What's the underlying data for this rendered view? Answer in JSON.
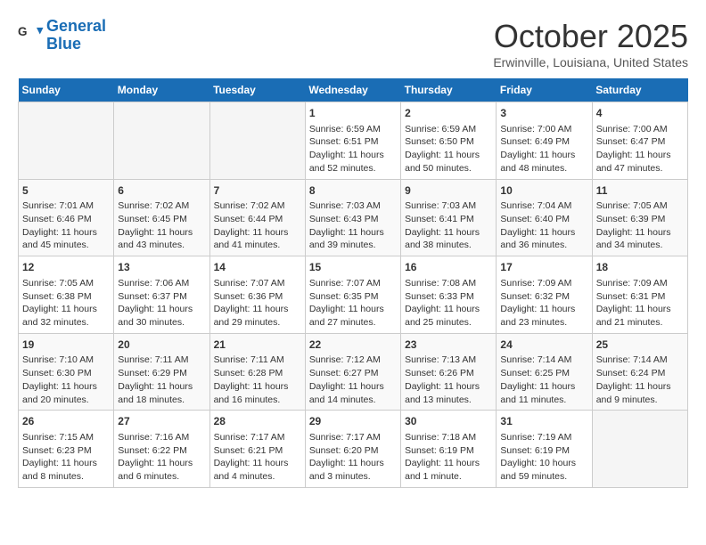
{
  "header": {
    "logo_line1": "General",
    "logo_line2": "Blue",
    "month_title": "October 2025",
    "location": "Erwinville, Louisiana, United States"
  },
  "weekdays": [
    "Sunday",
    "Monday",
    "Tuesday",
    "Wednesday",
    "Thursday",
    "Friday",
    "Saturday"
  ],
  "weeks": [
    [
      {
        "day": "",
        "empty": true
      },
      {
        "day": "",
        "empty": true
      },
      {
        "day": "",
        "empty": true
      },
      {
        "day": "1",
        "sunrise": "6:59 AM",
        "sunset": "6:51 PM",
        "daylight": "11 hours and 52 minutes."
      },
      {
        "day": "2",
        "sunrise": "6:59 AM",
        "sunset": "6:50 PM",
        "daylight": "11 hours and 50 minutes."
      },
      {
        "day": "3",
        "sunrise": "7:00 AM",
        "sunset": "6:49 PM",
        "daylight": "11 hours and 48 minutes."
      },
      {
        "day": "4",
        "sunrise": "7:00 AM",
        "sunset": "6:47 PM",
        "daylight": "11 hours and 47 minutes."
      }
    ],
    [
      {
        "day": "5",
        "sunrise": "7:01 AM",
        "sunset": "6:46 PM",
        "daylight": "11 hours and 45 minutes."
      },
      {
        "day": "6",
        "sunrise": "7:02 AM",
        "sunset": "6:45 PM",
        "daylight": "11 hours and 43 minutes."
      },
      {
        "day": "7",
        "sunrise": "7:02 AM",
        "sunset": "6:44 PM",
        "daylight": "11 hours and 41 minutes."
      },
      {
        "day": "8",
        "sunrise": "7:03 AM",
        "sunset": "6:43 PM",
        "daylight": "11 hours and 39 minutes."
      },
      {
        "day": "9",
        "sunrise": "7:03 AM",
        "sunset": "6:41 PM",
        "daylight": "11 hours and 38 minutes."
      },
      {
        "day": "10",
        "sunrise": "7:04 AM",
        "sunset": "6:40 PM",
        "daylight": "11 hours and 36 minutes."
      },
      {
        "day": "11",
        "sunrise": "7:05 AM",
        "sunset": "6:39 PM",
        "daylight": "11 hours and 34 minutes."
      }
    ],
    [
      {
        "day": "12",
        "sunrise": "7:05 AM",
        "sunset": "6:38 PM",
        "daylight": "11 hours and 32 minutes."
      },
      {
        "day": "13",
        "sunrise": "7:06 AM",
        "sunset": "6:37 PM",
        "daylight": "11 hours and 30 minutes."
      },
      {
        "day": "14",
        "sunrise": "7:07 AM",
        "sunset": "6:36 PM",
        "daylight": "11 hours and 29 minutes."
      },
      {
        "day": "15",
        "sunrise": "7:07 AM",
        "sunset": "6:35 PM",
        "daylight": "11 hours and 27 minutes."
      },
      {
        "day": "16",
        "sunrise": "7:08 AM",
        "sunset": "6:33 PM",
        "daylight": "11 hours and 25 minutes."
      },
      {
        "day": "17",
        "sunrise": "7:09 AM",
        "sunset": "6:32 PM",
        "daylight": "11 hours and 23 minutes."
      },
      {
        "day": "18",
        "sunrise": "7:09 AM",
        "sunset": "6:31 PM",
        "daylight": "11 hours and 21 minutes."
      }
    ],
    [
      {
        "day": "19",
        "sunrise": "7:10 AM",
        "sunset": "6:30 PM",
        "daylight": "11 hours and 20 minutes."
      },
      {
        "day": "20",
        "sunrise": "7:11 AM",
        "sunset": "6:29 PM",
        "daylight": "11 hours and 18 minutes."
      },
      {
        "day": "21",
        "sunrise": "7:11 AM",
        "sunset": "6:28 PM",
        "daylight": "11 hours and 16 minutes."
      },
      {
        "day": "22",
        "sunrise": "7:12 AM",
        "sunset": "6:27 PM",
        "daylight": "11 hours and 14 minutes."
      },
      {
        "day": "23",
        "sunrise": "7:13 AM",
        "sunset": "6:26 PM",
        "daylight": "11 hours and 13 minutes."
      },
      {
        "day": "24",
        "sunrise": "7:14 AM",
        "sunset": "6:25 PM",
        "daylight": "11 hours and 11 minutes."
      },
      {
        "day": "25",
        "sunrise": "7:14 AM",
        "sunset": "6:24 PM",
        "daylight": "11 hours and 9 minutes."
      }
    ],
    [
      {
        "day": "26",
        "sunrise": "7:15 AM",
        "sunset": "6:23 PM",
        "daylight": "11 hours and 8 minutes."
      },
      {
        "day": "27",
        "sunrise": "7:16 AM",
        "sunset": "6:22 PM",
        "daylight": "11 hours and 6 minutes."
      },
      {
        "day": "28",
        "sunrise": "7:17 AM",
        "sunset": "6:21 PM",
        "daylight": "11 hours and 4 minutes."
      },
      {
        "day": "29",
        "sunrise": "7:17 AM",
        "sunset": "6:20 PM",
        "daylight": "11 hours and 3 minutes."
      },
      {
        "day": "30",
        "sunrise": "7:18 AM",
        "sunset": "6:19 PM",
        "daylight": "11 hours and 1 minute."
      },
      {
        "day": "31",
        "sunrise": "7:19 AM",
        "sunset": "6:19 PM",
        "daylight": "10 hours and 59 minutes."
      },
      {
        "day": "",
        "empty": true
      }
    ]
  ]
}
